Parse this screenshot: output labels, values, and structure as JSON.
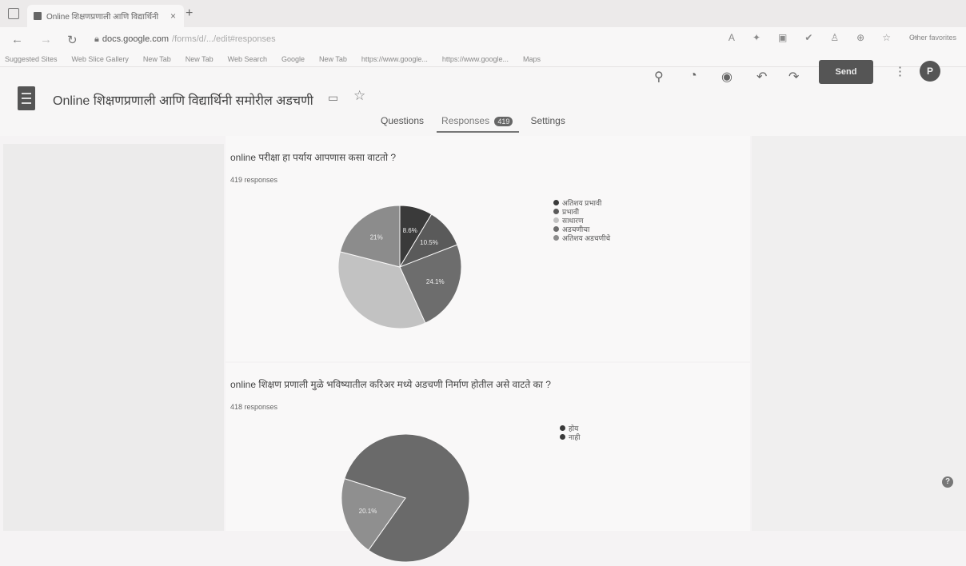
{
  "browser": {
    "tab_title": "Online शिक्षणप्रणाली आणि विद्यार्थिनी",
    "tab_close": "×",
    "new_tab": "+",
    "url_host": "docs.google.com",
    "url_path": "/forms/d/.../edit#responses",
    "other_favorites": "Other favorites",
    "bookmarks": [
      "Suggested Sites",
      "Web Slice Gallery",
      "New Tab",
      "New Tab",
      "Web Search",
      "Google",
      "New Tab",
      "https://www.google...",
      "https://www.google...",
      "Maps"
    ]
  },
  "form": {
    "title": "Online शिक्षणप्रणाली आणि विद्यार्थिनी समोरील अडचणी",
    "send_label": "Send",
    "avatar_letter": "P",
    "tabs": {
      "questions": "Questions",
      "responses": "Responses",
      "responses_count": "419",
      "settings": "Settings"
    }
  },
  "questions": [
    {
      "title": "online परीक्षा हा पर्याय आपणास कसा वाटतो ?",
      "responses": "419 responses",
      "legend": [
        "अतिशय प्रभावी",
        "प्रभावी",
        "साधारण",
        "अडचणीचा",
        "अतिशय अडचणीचे"
      ]
    },
    {
      "title": "online शिक्षण प्रणाली मुळे भविष्यातील करिअर मध्ये अडचणी निर्माण होतील असे वाटते का ?",
      "responses": "418 responses",
      "legend": [
        "होय",
        "नाही"
      ]
    }
  ],
  "chart_data": [
    {
      "type": "pie",
      "slices": [
        {
          "label": "अतिशय प्रभावी",
          "value": 8.6,
          "color": "#3a3a3a"
        },
        {
          "label": "प्रभावी",
          "value": 10.5,
          "color": "#5a5a5a"
        },
        {
          "label": "साधारण",
          "value": 24.1,
          "color": "#6d6d6d"
        },
        {
          "label": "अडचणीचा",
          "value": 35.8,
          "color": "#c2c2c2"
        },
        {
          "label": "अतिशय अडचणीचे",
          "value": 21,
          "color": "#8c8c8c"
        }
      ],
      "data_labels": [
        "8.6%",
        "10.5%",
        "24.1%",
        "",
        "21%"
      ]
    },
    {
      "type": "pie",
      "slices": [
        {
          "label": "होय",
          "value": 79.9,
          "color": "#6a6a6a"
        },
        {
          "label": "नाही",
          "value": 20.1,
          "color": "#8f8f8f"
        }
      ],
      "data_labels": [
        "",
        "20.1%"
      ]
    }
  ]
}
